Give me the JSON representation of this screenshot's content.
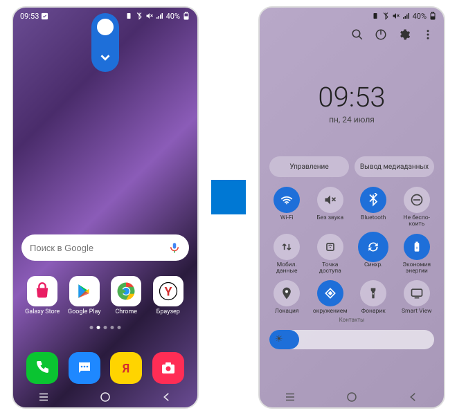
{
  "status": {
    "time": "09:53",
    "battery": "40%"
  },
  "search": {
    "placeholder": "Поиск в Google"
  },
  "apps": [
    {
      "name": "galaxy-store",
      "label": "Galaxy Store",
      "bg": "#fff"
    },
    {
      "name": "google-play",
      "label": "Google Play",
      "bg": "#fff"
    },
    {
      "name": "chrome",
      "label": "Chrome",
      "bg": "#fff"
    },
    {
      "name": "browser",
      "label": "Браузер",
      "bg": "#fff"
    }
  ],
  "dock": [
    {
      "name": "phone",
      "bg": "#0ac431"
    },
    {
      "name": "messages",
      "bg": "#1e88ff"
    },
    {
      "name": "yandex",
      "bg": "#ffd400"
    },
    {
      "name": "camera",
      "bg": "#ff2d55"
    }
  ],
  "qs": {
    "time": "09:53",
    "date": "пн, 24 июля",
    "control_btn": "Управление",
    "media_btn": "Вывод медиаданных",
    "subtext": "Контакты",
    "tiles": [
      {
        "name": "wifi",
        "label": "Wi-Fi",
        "active": true
      },
      {
        "name": "mute",
        "label": "Без звука",
        "active": false
      },
      {
        "name": "bluetooth",
        "label": "Bluetooth",
        "active": true
      },
      {
        "name": "dnd",
        "label": "Не беспо-\nкоить",
        "active": false
      },
      {
        "name": "mobile-data",
        "label": "Мобил.\nданные",
        "active": false
      },
      {
        "name": "hotspot",
        "label": "Точка\nдоступа",
        "active": false
      },
      {
        "name": "sync",
        "label": "Синхр.",
        "active": true,
        "highlighted": true
      },
      {
        "name": "battery-saver",
        "label": "Экономия\nэнергии",
        "active": true
      },
      {
        "name": "location",
        "label": "Локация",
        "active": false
      },
      {
        "name": "nearby",
        "label": "окружением",
        "active": true
      },
      {
        "name": "flashlight",
        "label": "Фонарик",
        "active": false
      },
      {
        "name": "smartview",
        "label": "Smart View",
        "active": false
      }
    ]
  }
}
